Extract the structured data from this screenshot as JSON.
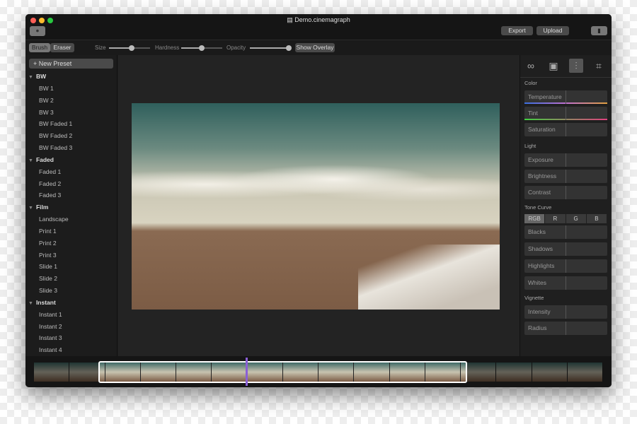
{
  "window": {
    "title": "Demo.cinemagraph",
    "export_label": "Export",
    "upload_label": "Upload"
  },
  "toolbar": {
    "brush": "Brush",
    "eraser": "Eraser",
    "size": "Size",
    "hardness": "Hardness",
    "opacity": "Opacity",
    "size_value": 0.55,
    "hardness_value": 0.55,
    "opacity_value": 1.0,
    "show_overlay": "Show Overlay"
  },
  "sidebar": {
    "new_preset": "New Preset",
    "groups": [
      {
        "name": "BW",
        "items": [
          "BW 1",
          "BW 2",
          "BW 3",
          "BW Faded 1",
          "BW Faded 2",
          "BW Faded 3"
        ]
      },
      {
        "name": "Faded",
        "items": [
          "Faded 1",
          "Faded 2",
          "Faded 3"
        ]
      },
      {
        "name": "Film",
        "items": [
          "Landscape",
          "Print 1",
          "Print 2",
          "Print 3",
          "Slide 1",
          "Slide 2",
          "Slide 3"
        ]
      },
      {
        "name": "Instant",
        "items": [
          "Instant 1",
          "Instant 2",
          "Instant 3",
          "Instant 4"
        ]
      }
    ]
  },
  "right_panel": {
    "tabs": [
      "loop-icon",
      "image-icon",
      "sliders-icon",
      "crop-icon"
    ],
    "color": "Color",
    "temperature": "Temperature",
    "tint": "Tint",
    "saturation": "Saturation",
    "light": "Light",
    "exposure": "Exposure",
    "brightness": "Brightness",
    "contrast": "Contrast",
    "tone_curve": "Tone Curve",
    "channels": [
      "RGB",
      "R",
      "G",
      "B"
    ],
    "blacks": "Blacks",
    "shadows": "Shadows",
    "highlights": "Highlights",
    "whites": "Whites",
    "vignette": "Vignette",
    "intensity": "Intensity",
    "radius": "Radius"
  },
  "colors": {
    "playhead": "#8a5fd6",
    "temperature_gradient": [
      "#3a6fe0",
      "#c070d0",
      "#e0a040"
    ],
    "tint_gradient": [
      "#40d040",
      "#e04080"
    ]
  }
}
